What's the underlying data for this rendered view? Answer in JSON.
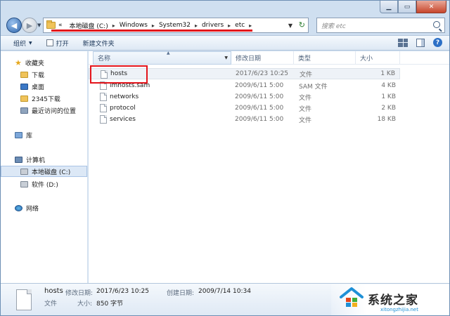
{
  "address": {
    "prefix": "«",
    "crumbs": [
      "本地磁盘 (C:)",
      "Windows",
      "System32",
      "drivers",
      "etc"
    ],
    "separator": "▸"
  },
  "search": {
    "placeholder": "搜索 etc"
  },
  "toolbar": {
    "organize": "组织",
    "open": "打开",
    "new_folder": "新建文件夹"
  },
  "nav": {
    "favorites": "收藏夹",
    "downloads": "下载",
    "desktop": "桌面",
    "downloads_2345": "2345下载",
    "recent": "最近访问的位置",
    "libraries": "库",
    "computer": "计算机",
    "drive_c": "本地磁盘 (C:)",
    "drive_d": "软件 (D:)",
    "network": "网络"
  },
  "columns": {
    "name": "名称",
    "date": "修改日期",
    "type": "类型",
    "size": "大小"
  },
  "files": [
    {
      "name": "hosts",
      "date": "2017/6/23 10:25",
      "type": "文件",
      "size": "1 KB"
    },
    {
      "name": "lmhosts.sam",
      "date": "2009/6/11 5:00",
      "type": "SAM 文件",
      "size": "4 KB"
    },
    {
      "name": "networks",
      "date": "2009/6/11 5:00",
      "type": "文件",
      "size": "1 KB"
    },
    {
      "name": "protocol",
      "date": "2009/6/11 5:00",
      "type": "文件",
      "size": "2 KB"
    },
    {
      "name": "services",
      "date": "2009/6/11 5:00",
      "type": "文件",
      "size": "18 KB"
    }
  ],
  "details": {
    "name": "hosts",
    "type": "文件",
    "modified_label": "修改日期:",
    "modified_value": "2017/6/23 10:25",
    "created_label": "创建日期:",
    "created_value": "2009/7/14 10:34",
    "size_label": "大小:",
    "size_value": "850 字节"
  },
  "watermark": {
    "text": "系统之家",
    "url": "xitongzhijia.net"
  },
  "colors": {
    "highlight_red": "#e3141b",
    "chrome_blue": "#cfdff0"
  }
}
